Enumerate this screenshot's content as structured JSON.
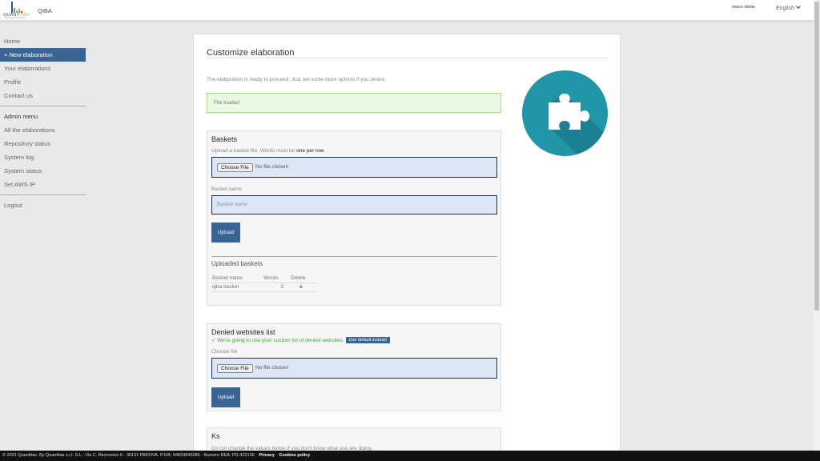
{
  "header": {
    "logo_text_main": "QUANT",
    "logo_text_accent": "ITAS",
    "logo_tagline": "Data-driven Innovation",
    "app_name": "QIBA",
    "user_name": "marco stefan",
    "language": "English"
  },
  "sidebar": {
    "items": [
      {
        "label": "Home"
      },
      {
        "label": "+ New elaboration"
      },
      {
        "label": "Your elaborations"
      },
      {
        "label": "Profile"
      },
      {
        "label": "Contact us"
      }
    ],
    "admin_heading": "Admin menu",
    "admin_items": [
      {
        "label": "All the elaborations"
      },
      {
        "label": "Repository status"
      },
      {
        "label": "System log"
      },
      {
        "label": "System status"
      },
      {
        "label": "Set AWS IP"
      }
    ],
    "logout": "Logout"
  },
  "main": {
    "title": "Customize elaboration",
    "intro": "The elaboration is ready to proceed. Just set some more options if you desire.",
    "alert": "File loaded",
    "baskets": {
      "title": "Baskets",
      "help_prefix": "Upload a basket file. Words must be ",
      "help_emph": "one per row",
      "help_suffix": ".",
      "file_button": "Choose File",
      "file_status": "No file chosen",
      "name_label": "Basket name",
      "name_placeholder": "Basket name",
      "upload_label": "Upload",
      "uploaded_title": "Uploaded baskets",
      "columns": [
        "Basket name",
        "Words",
        "Delete"
      ],
      "rows": [
        {
          "name": "qiba basket",
          "words": "3",
          "delete": "x"
        }
      ]
    },
    "denied": {
      "title": "Denied websites list",
      "status": "✓ We're going to use your custom list of denied websites.",
      "default_button": "Use default instead",
      "file_label": "Choose file",
      "file_button": "Choose File",
      "file_status": "No file chosen",
      "upload_label": "Upload"
    },
    "ks": {
      "title": "Ks",
      "help": "Do not change the values below if you don't know what you are doing."
    }
  },
  "footer": {
    "text": "© 2021 Quantitas. By Quantitas s.r.l. S.L.: Via C. Rezzonico 6 - 35131 PADOVA. P.IVA: 04833640289 - Numero REA: PD-422136",
    "privacy": "Privacy",
    "cookies": "Cookies policy"
  },
  "colors": {
    "primary": "#3a6593",
    "puzzle_circle": "#2196a9",
    "alert_bg": "#eaf8e4",
    "delete": "#c9302c"
  }
}
